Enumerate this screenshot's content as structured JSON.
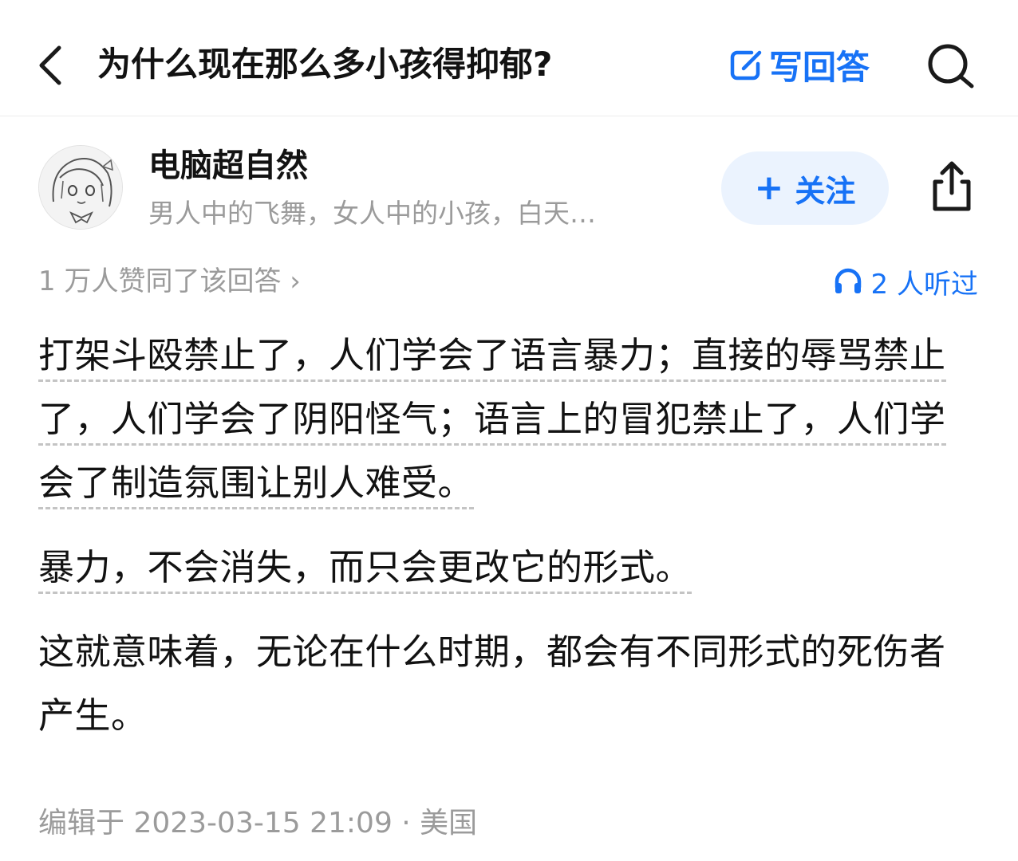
{
  "header": {
    "back_icon": "chevron-left-icon",
    "title": "为什么现在那么多小孩得抑郁?",
    "write_answer_label": "写回答",
    "write_icon": "edit-icon",
    "search_icon": "search-icon",
    "accent_color": "#1772f6"
  },
  "author": {
    "name": "电脑超自然",
    "bio": "男人中的飞舞，女人中的小孩，白天…",
    "follow_label": "关注",
    "follow_plus": "+",
    "share_icon": "share-icon"
  },
  "stats": {
    "votes_text": "1 万人赞同了该回答",
    "votes_chevron": "›",
    "listen_text": "2 人听过",
    "listen_icon": "headphones-icon"
  },
  "answer": {
    "paragraphs": [
      "打架斗殴禁止了，人们学会了语言暴力；直接的辱骂禁止了，人们学会了阴阳怪气；语言上的冒犯禁止了，人们学会了制造氛围让别人难受。",
      "暴力，不会消失，而只会更改它的形式。",
      "这就意味着，无论在什么时期，都会有不同形式的死伤者产生。"
    ]
  },
  "meta": {
    "edited_text": "编辑于 2023-03-15 21:09 · 美国"
  }
}
